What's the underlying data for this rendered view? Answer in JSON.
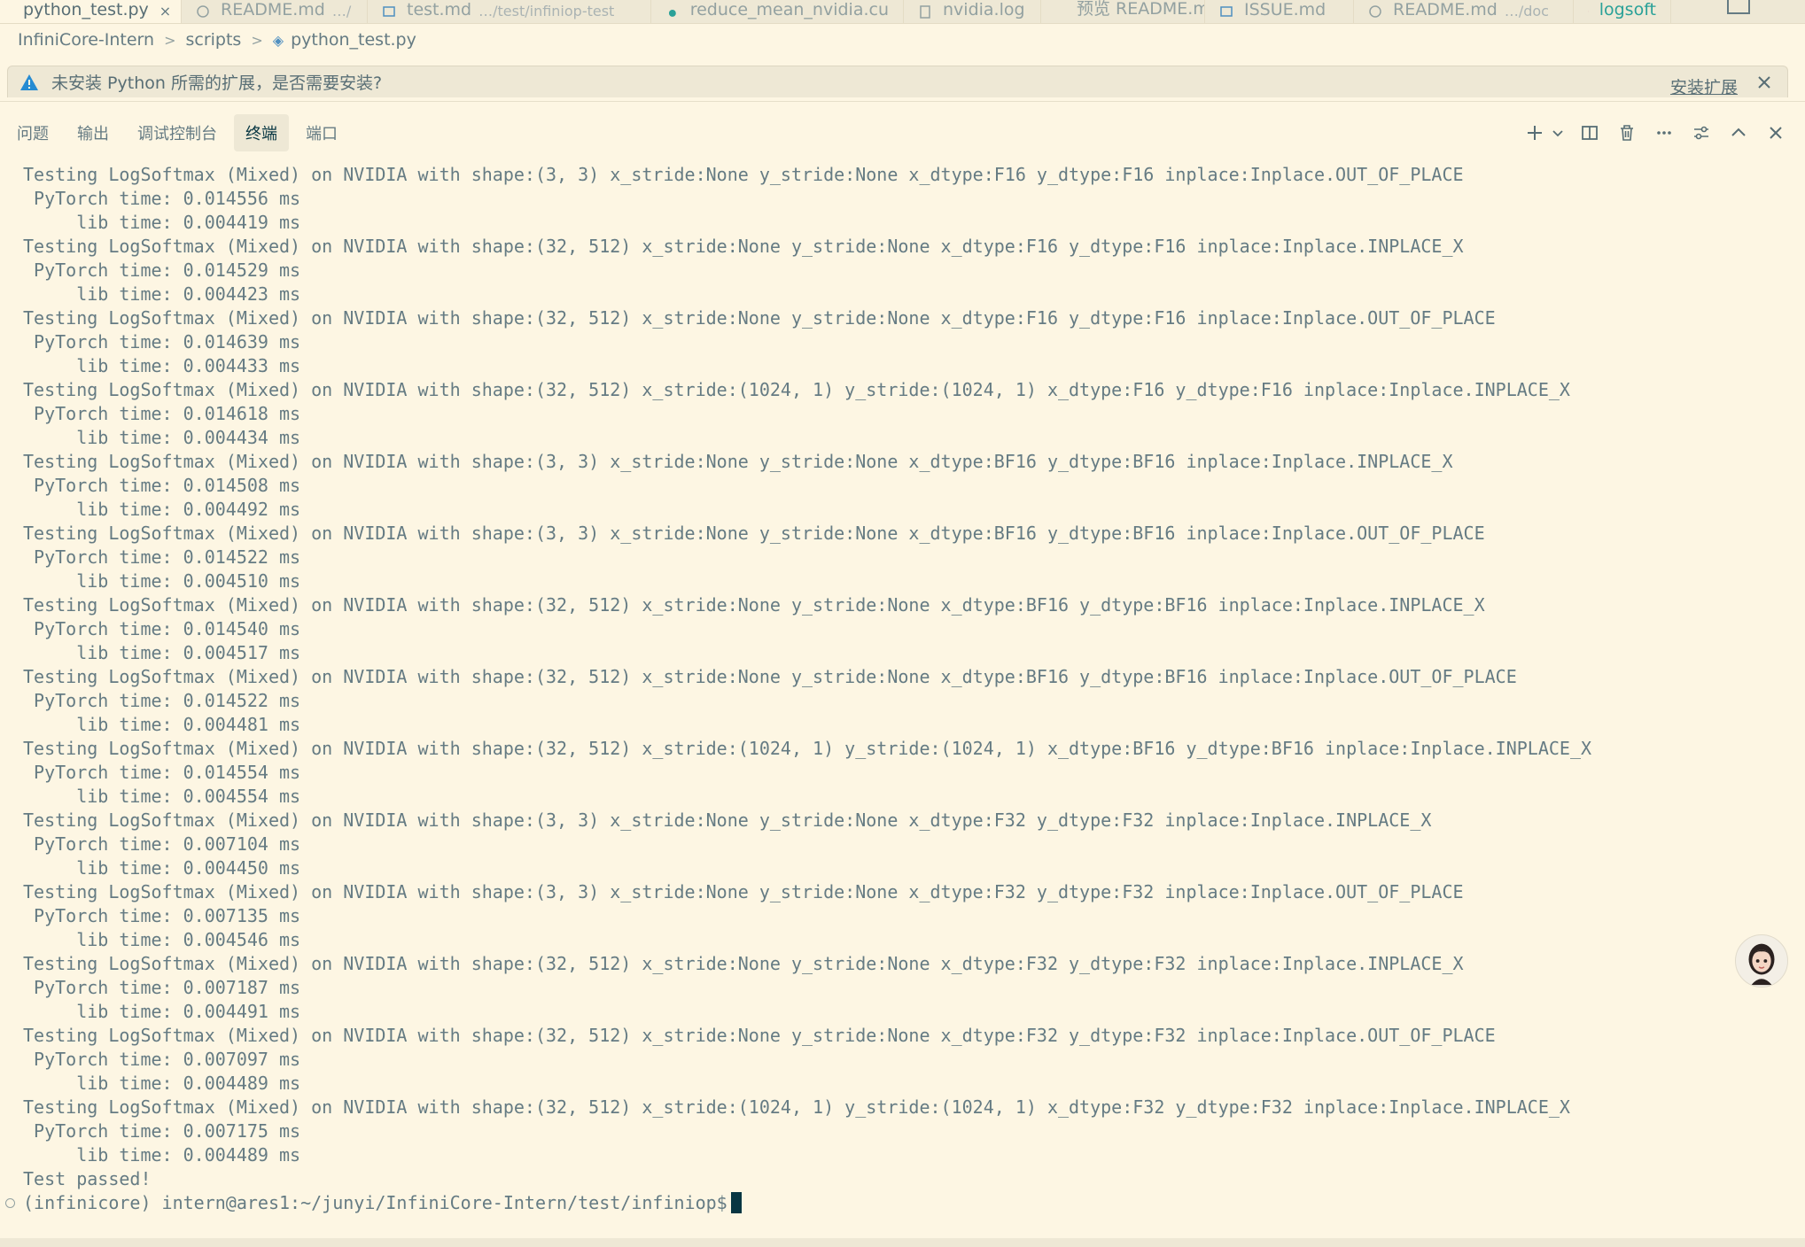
{
  "tabs": [
    {
      "label": "python_test.py",
      "path": "",
      "active": true,
      "close": "×"
    },
    {
      "label": "README.md",
      "path": "…/",
      "active": false,
      "close": ""
    },
    {
      "label": "test.md",
      "path": "…/test/infiniop-test",
      "active": false,
      "close": ""
    },
    {
      "label": "reduce_mean_nvidia.cu",
      "path": "",
      "active": false,
      "close": ""
    },
    {
      "label": "nvidia.log",
      "path": "",
      "active": false,
      "close": ""
    },
    {
      "label": "预览 README.md",
      "path": "",
      "active": false,
      "close": ""
    },
    {
      "label": "ISSUE.md",
      "path": "",
      "active": false,
      "close": ""
    },
    {
      "label": "README.md",
      "path": "…/doc",
      "active": false,
      "close": ""
    },
    {
      "label": "logsoft",
      "path": "",
      "active": false,
      "close": ""
    }
  ],
  "breadcrumb": {
    "items": [
      "InfiniCore-Intern",
      "scripts",
      "python_test.py"
    ],
    "separator": ">"
  },
  "notification": {
    "message": "未安装 Python 所需的扩展，是否需要安装?",
    "action": "安装扩展"
  },
  "panel": {
    "tabs": [
      "问题",
      "输出",
      "调试控制台",
      "终端",
      "端口"
    ],
    "active_tab": "终端"
  },
  "terminal": {
    "lines": [
      "Testing LogSoftmax (Mixed) on NVIDIA with shape:(3, 3) x_stride:None y_stride:None x_dtype:F16 y_dtype:F16 inplace:Inplace.OUT_OF_PLACE",
      " PyTorch time: 0.014556 ms",
      "     lib time: 0.004419 ms",
      "Testing LogSoftmax (Mixed) on NVIDIA with shape:(32, 512) x_stride:None y_stride:None x_dtype:F16 y_dtype:F16 inplace:Inplace.INPLACE_X",
      " PyTorch time: 0.014529 ms",
      "     lib time: 0.004423 ms",
      "Testing LogSoftmax (Mixed) on NVIDIA with shape:(32, 512) x_stride:None y_stride:None x_dtype:F16 y_dtype:F16 inplace:Inplace.OUT_OF_PLACE",
      " PyTorch time: 0.014639 ms",
      "     lib time: 0.004433 ms",
      "Testing LogSoftmax (Mixed) on NVIDIA with shape:(32, 512) x_stride:(1024, 1) y_stride:(1024, 1) x_dtype:F16 y_dtype:F16 inplace:Inplace.INPLACE_X",
      " PyTorch time: 0.014618 ms",
      "     lib time: 0.004434 ms",
      "Testing LogSoftmax (Mixed) on NVIDIA with shape:(3, 3) x_stride:None y_stride:None x_dtype:BF16 y_dtype:BF16 inplace:Inplace.INPLACE_X",
      " PyTorch time: 0.014508 ms",
      "     lib time: 0.004492 ms",
      "Testing LogSoftmax (Mixed) on NVIDIA with shape:(3, 3) x_stride:None y_stride:None x_dtype:BF16 y_dtype:BF16 inplace:Inplace.OUT_OF_PLACE",
      " PyTorch time: 0.014522 ms",
      "     lib time: 0.004510 ms",
      "Testing LogSoftmax (Mixed) on NVIDIA with shape:(32, 512) x_stride:None y_stride:None x_dtype:BF16 y_dtype:BF16 inplace:Inplace.INPLACE_X",
      " PyTorch time: 0.014540 ms",
      "     lib time: 0.004517 ms",
      "Testing LogSoftmax (Mixed) on NVIDIA with shape:(32, 512) x_stride:None y_stride:None x_dtype:BF16 y_dtype:BF16 inplace:Inplace.OUT_OF_PLACE",
      " PyTorch time: 0.014522 ms",
      "     lib time: 0.004481 ms",
      "Testing LogSoftmax (Mixed) on NVIDIA with shape:(32, 512) x_stride:(1024, 1) y_stride:(1024, 1) x_dtype:BF16 y_dtype:BF16 inplace:Inplace.INPLACE_X",
      " PyTorch time: 0.014554 ms",
      "     lib time: 0.004554 ms",
      "Testing LogSoftmax (Mixed) on NVIDIA with shape:(3, 3) x_stride:None y_stride:None x_dtype:F32 y_dtype:F32 inplace:Inplace.INPLACE_X",
      " PyTorch time: 0.007104 ms",
      "     lib time: 0.004450 ms",
      "Testing LogSoftmax (Mixed) on NVIDIA with shape:(3, 3) x_stride:None y_stride:None x_dtype:F32 y_dtype:F32 inplace:Inplace.OUT_OF_PLACE",
      " PyTorch time: 0.007135 ms",
      "     lib time: 0.004546 ms",
      "Testing LogSoftmax (Mixed) on NVIDIA with shape:(32, 512) x_stride:None y_stride:None x_dtype:F32 y_dtype:F32 inplace:Inplace.INPLACE_X",
      " PyTorch time: 0.007187 ms",
      "     lib time: 0.004491 ms",
      "Testing LogSoftmax (Mixed) on NVIDIA with shape:(32, 512) x_stride:None y_stride:None x_dtype:F32 y_dtype:F32 inplace:Inplace.OUT_OF_PLACE",
      " PyTorch time: 0.007097 ms",
      "     lib time: 0.004489 ms",
      "Testing LogSoftmax (Mixed) on NVIDIA with shape:(32, 512) x_stride:(1024, 1) y_stride:(1024, 1) x_dtype:F32 y_dtype:F32 inplace:Inplace.INPLACE_X",
      " PyTorch time: 0.007175 ms",
      "     lib time: 0.004489 ms",
      "Test passed!"
    ],
    "prompt": "(infinicore) intern@ares1:~/junyi/InfiniCore-Intern/test/infiniop$"
  },
  "colors": {
    "background": "#fdf6e3",
    "chrome": "#eee8d5",
    "text": "#657b83",
    "accent_blue": "#268bd2",
    "cursor": "#073642"
  },
  "icons": {
    "panel_actions": [
      "plus-icon",
      "chevron-down-icon",
      "split-icon",
      "trash-icon",
      "more-icon",
      "settings-sliders-icon",
      "chevron-up-icon",
      "close-icon"
    ],
    "notification": "warning-icon",
    "avatar": "assistant-avatar"
  }
}
